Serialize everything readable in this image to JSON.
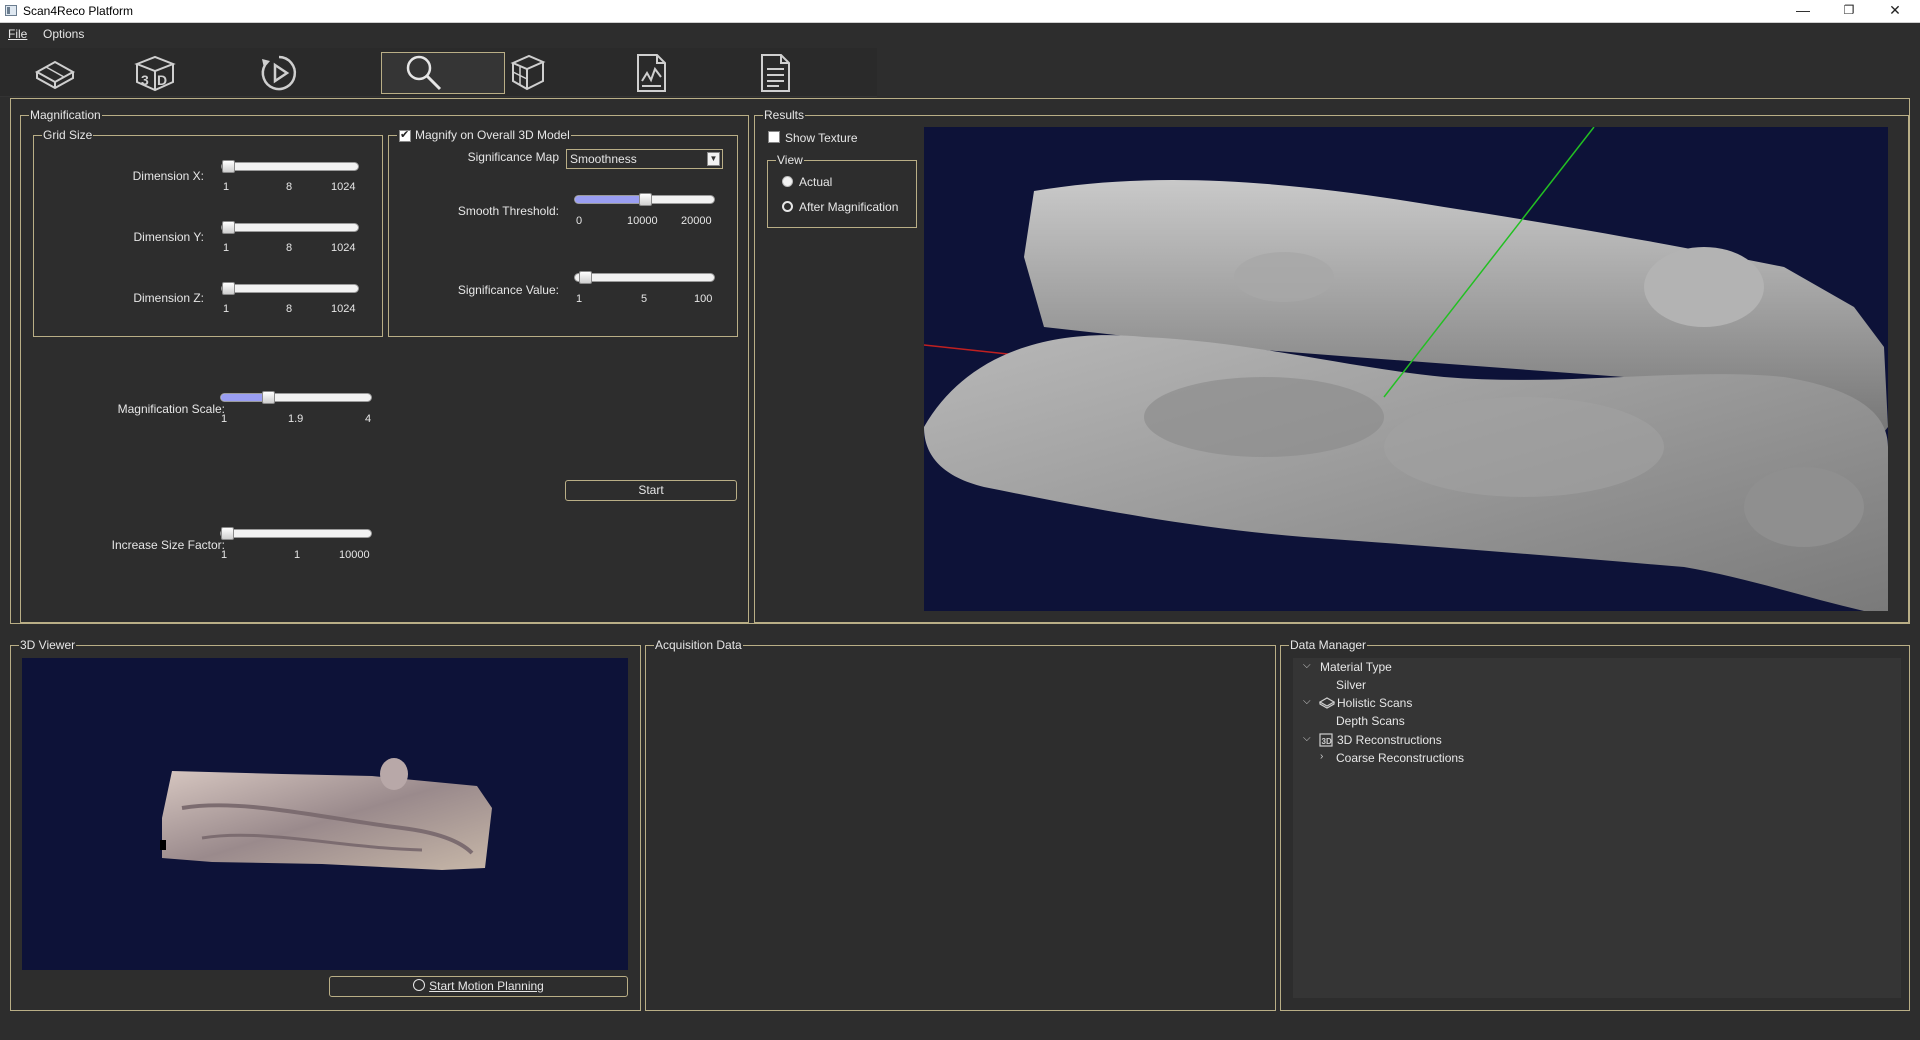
{
  "app": {
    "title": "Scan4Reco Platform"
  },
  "window_controls": {
    "minimize": "—",
    "restore": "❐",
    "close": "✕"
  },
  "menu": {
    "file": "File",
    "options": "Options"
  },
  "toolbar": {
    "buttons": [
      {
        "icon": "holistic-scan-icon"
      },
      {
        "icon": "3d-icon"
      },
      {
        "icon": "play-icon"
      },
      {
        "icon": "magnify-icon",
        "active": true
      },
      {
        "icon": "cube-icon"
      },
      {
        "icon": "report-chart-icon"
      },
      {
        "icon": "document-icon"
      }
    ]
  },
  "magnification": {
    "title": "Magnification",
    "grid_size": {
      "title": "Grid Size",
      "dim_x": {
        "label": "Dimension X:",
        "min": "1",
        "value": "8",
        "max": "1024",
        "fraction": 0.0
      },
      "dim_y": {
        "label": "Dimension Y:",
        "min": "1",
        "value": "8",
        "max": "1024",
        "fraction": 0.0
      },
      "dim_z": {
        "label": "Dimension Z:",
        "min": "1",
        "value": "8",
        "max": "1024",
        "fraction": 0.0
      }
    },
    "overall": {
      "checkbox_label": "Magnify on Overall 3D Model",
      "checked": true,
      "significance_map_label": "Significance Map",
      "significance_map_value": "Smoothness",
      "smooth_threshold": {
        "label": "Smooth Threshold:",
        "min": "0",
        "value": "10000",
        "max": "20000",
        "fraction": 0.5
      },
      "significance_value": {
        "label": "Significance Value:",
        "min": "1",
        "value": "5",
        "max": "100",
        "fraction": 0.04
      }
    },
    "scale": {
      "label": "Magnification Scale:",
      "min": "1",
      "value": "1.9",
      "max": "4",
      "fraction": 0.3
    },
    "increase": {
      "label": "Increase Size Factor:",
      "min": "1",
      "value": "1",
      "max": "10000",
      "fraction": 0.0
    },
    "start_button": "Start"
  },
  "results": {
    "title": "Results",
    "show_texture": "Show Texture",
    "view": {
      "title": "View",
      "actual": "Actual",
      "after": "After Magnification"
    }
  },
  "viewer": {
    "title": "3D Viewer",
    "start_motion": "Start Motion Planning"
  },
  "acquisition": {
    "title": "Acquisition Data"
  },
  "data_manager": {
    "title": "Data Manager",
    "items": [
      {
        "label": "Material Type"
      },
      {
        "label": "Silver"
      },
      {
        "label": "Holistic Scans"
      },
      {
        "label": "Depth Scans"
      },
      {
        "label": "3D Reconstructions"
      },
      {
        "label": "Coarse Reconstructions"
      }
    ]
  },
  "colors": {
    "background": "#2d2d2d",
    "frame": "#b9ae86",
    "viewport": "#0d1238",
    "slider_fill": "#9a9ef2"
  }
}
